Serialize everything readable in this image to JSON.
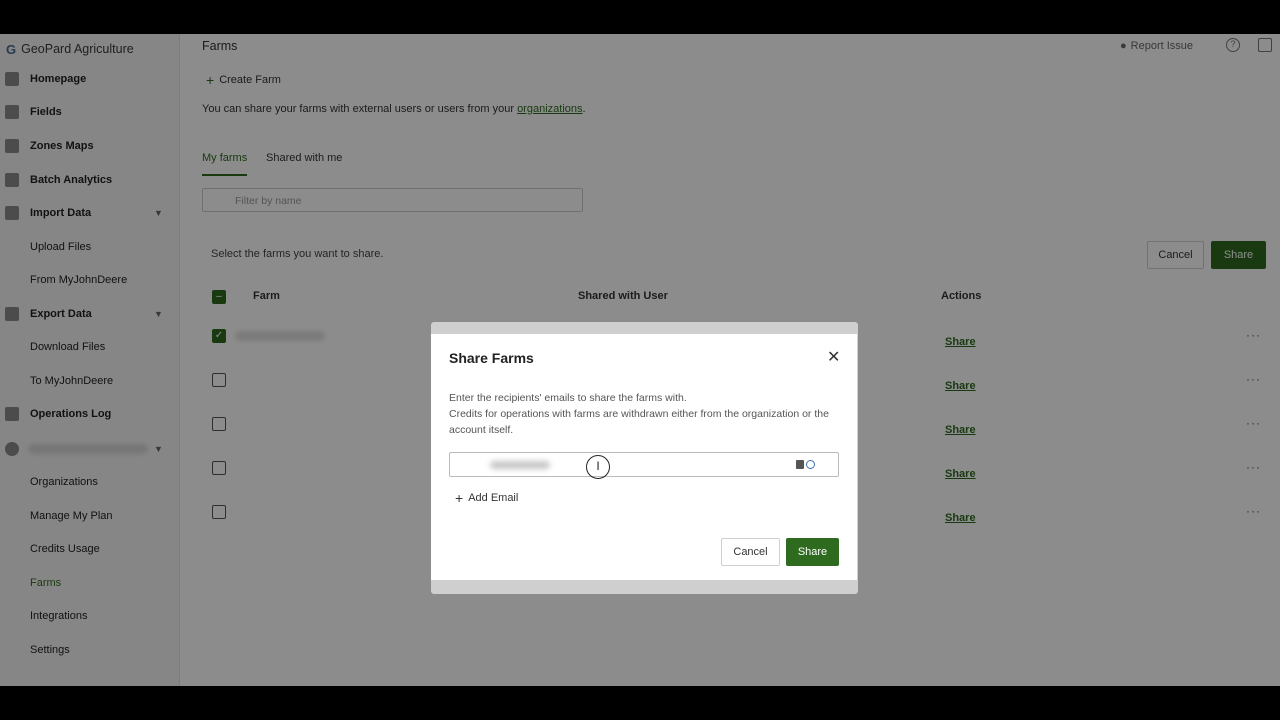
{
  "app": {
    "brand": "GeoPard Agriculture",
    "brand_logo": "G"
  },
  "header": {
    "page_title": "Farms",
    "report_issue": "Report Issue",
    "help": "?"
  },
  "sidebar": {
    "items": [
      {
        "label": "Homepage",
        "icon": "home-icon"
      },
      {
        "label": "Fields",
        "icon": "fields-icon"
      },
      {
        "label": "Zones Maps",
        "icon": "map-icon"
      },
      {
        "label": "Batch Analytics",
        "icon": "analytics-icon"
      },
      {
        "label": "Import Data",
        "icon": "download-icon"
      },
      {
        "label": "Upload Files"
      },
      {
        "label": "From MyJohnDeere"
      },
      {
        "label": "Export Data",
        "icon": "upload-icon"
      },
      {
        "label": "Download Files"
      },
      {
        "label": "To MyJohnDeere"
      },
      {
        "label": "Operations Log",
        "icon": "log-icon"
      },
      {
        "label": "Organizations"
      },
      {
        "label": "Manage My Plan"
      },
      {
        "label": "Credits Usage"
      },
      {
        "label": "Farms"
      },
      {
        "label": "Integrations"
      },
      {
        "label": "Settings"
      }
    ]
  },
  "main": {
    "create_farm": "Create Farm",
    "share_info": "You can share your farms with external users or users from your ",
    "share_info_link": "organizations",
    "share_info_end": ".",
    "tabs": [
      "My farms",
      "Shared with me"
    ],
    "filter_placeholder": "Filter by name",
    "select_text": "Select the farms you want to share.",
    "cancel": "Cancel",
    "share": "Share",
    "columns": [
      "Farm",
      "Shared with User",
      "Actions"
    ],
    "row_action": "Share",
    "rows_checked": [
      true,
      false,
      false,
      false,
      false
    ]
  },
  "modal": {
    "title": "Share Farms",
    "desc_line1": "Enter the recipients' emails to share the farms with.",
    "desc_line2": "Credits for operations with farms are withdrawn either from the organization or the account itself.",
    "add_email": "Add Email",
    "cancel": "Cancel",
    "share": "Share"
  },
  "colors": {
    "accent": "#2e6b1f"
  }
}
